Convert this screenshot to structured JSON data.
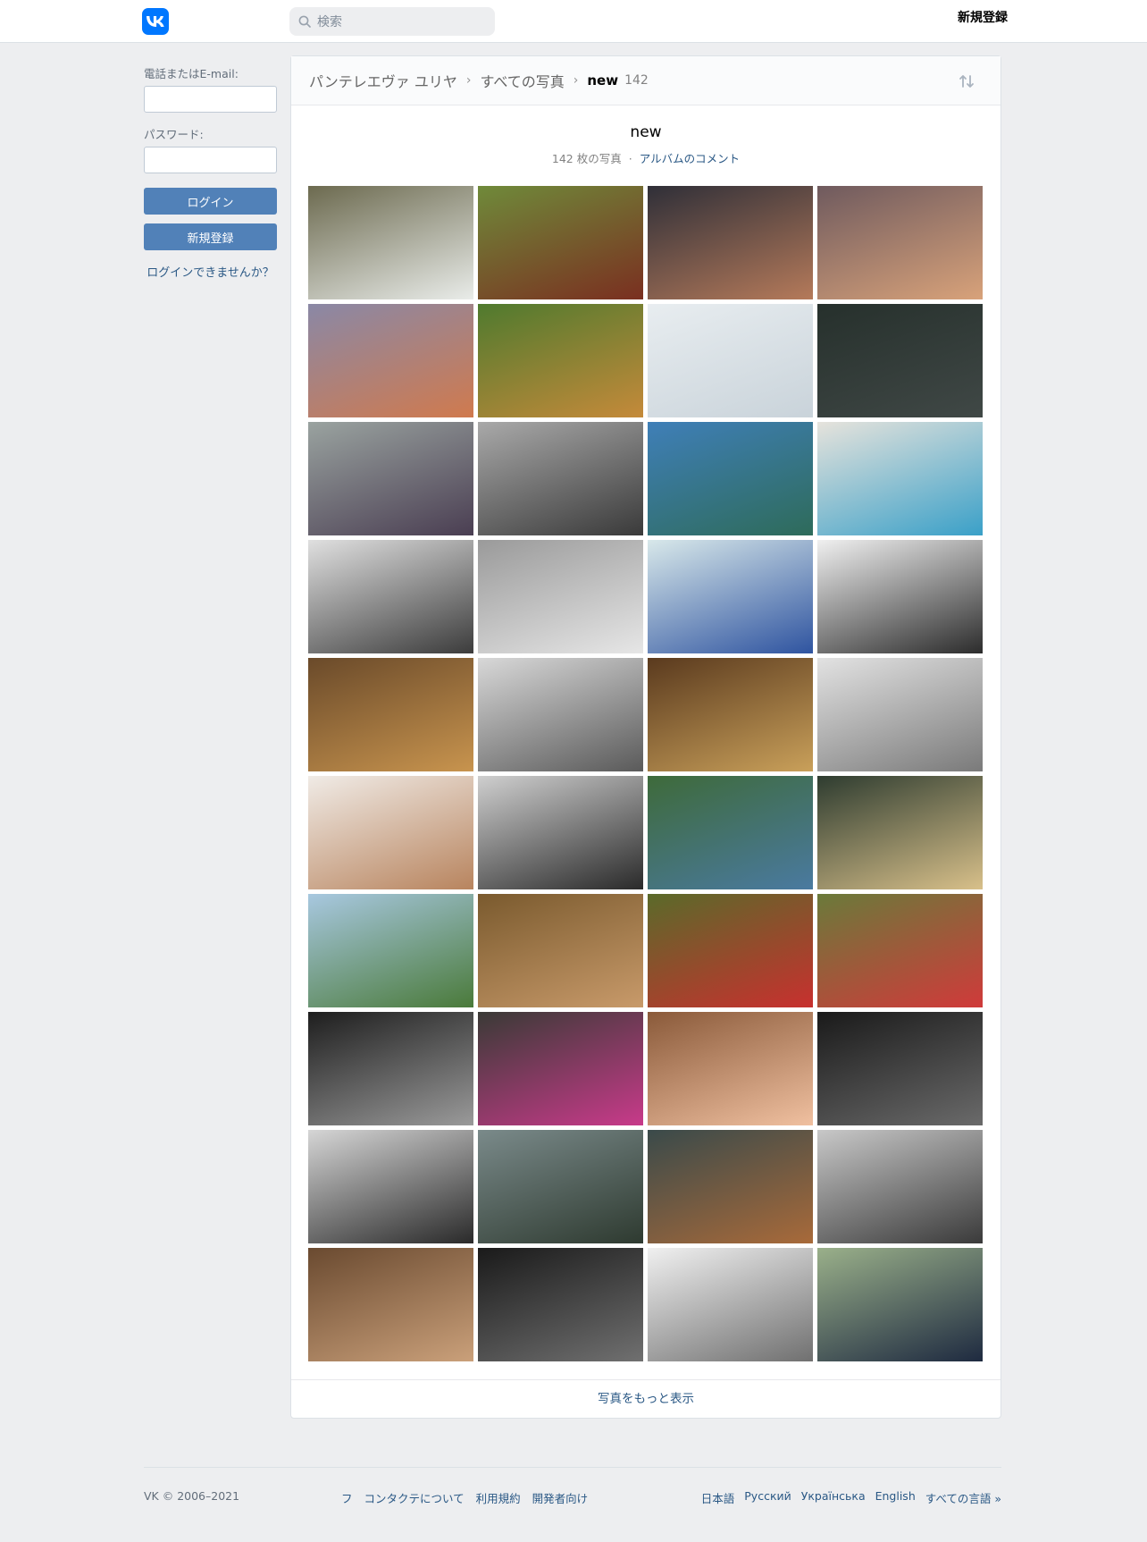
{
  "header": {
    "search_placeholder": "検索",
    "signup_label": "新規登録"
  },
  "sidebar": {
    "phone_label": "電話またはE-mail:",
    "password_label": "パスワード:",
    "login_button": "ログイン",
    "signup_button": "新規登録",
    "forgot_link": "ログインできませんか？"
  },
  "breadcrumb": {
    "user": "パンテレエヴァ ユリヤ",
    "all_photos": "すべての写真",
    "album": "new",
    "count": "142"
  },
  "album": {
    "title": "new",
    "photo_count": "142 枚の写真",
    "separator": "·",
    "comments_link": "アルバムのコメント"
  },
  "photos": [
    {
      "c1": "#6c6a4f",
      "c2": "#e9ece9"
    },
    {
      "c1": "#6f8a3a",
      "c2": "#7a2f20"
    },
    {
      "c1": "#2f2f38",
      "c2": "#b57a5a"
    },
    {
      "c1": "#6f5a5e",
      "c2": "#d8a27a"
    },
    {
      "c1": "#8a88a6",
      "c2": "#d07a4e"
    },
    {
      "c1": "#4f7a2e",
      "c2": "#c58a3a"
    },
    {
      "c1": "#e8edf0",
      "c2": "#c9d3da"
    },
    {
      "c1": "#26302c",
      "c2": "#404846"
    },
    {
      "c1": "#9aa3a0",
      "c2": "#4a3e52"
    },
    {
      "c1": "#a9a9a9",
      "c2": "#3a3a3a"
    },
    {
      "c1": "#3f7fb8",
      "c2": "#2e6b5a"
    },
    {
      "c1": "#e6e3dc",
      "c2": "#3aa0c8"
    },
    {
      "c1": "#e0e0e0",
      "c2": "#3c3c3c"
    },
    {
      "c1": "#9a9a9a",
      "c2": "#e6e6e6"
    },
    {
      "c1": "#d8e8ea",
      "c2": "#2f54a0"
    },
    {
      "c1": "#f0f0f0",
      "c2": "#2c2c2c"
    },
    {
      "c1": "#6a4a2a",
      "c2": "#c8944e"
    },
    {
      "c1": "#d8d8d8",
      "c2": "#5a5a5a"
    },
    {
      "c1": "#5a3a1e",
      "c2": "#c9a05a"
    },
    {
      "c1": "#e2e2e2",
      "c2": "#7a7a7a"
    },
    {
      "c1": "#f0ebe6",
      "c2": "#b8845e"
    },
    {
      "c1": "#cfcfcf",
      "c2": "#2a2a2a"
    },
    {
      "c1": "#3e6a3a",
      "c2": "#4a7aa0"
    },
    {
      "c1": "#2e3c30",
      "c2": "#d8c08a"
    },
    {
      "c1": "#a8c8e0",
      "c2": "#4a7a3a"
    },
    {
      "c1": "#7a5a2e",
      "c2": "#c89a6a"
    },
    {
      "c1": "#5a6a2a",
      "c2": "#c8302e"
    },
    {
      "c1": "#6a7a3a",
      "c2": "#d03a3a"
    },
    {
      "c1": "#1e1e1e",
      "c2": "#9a9a9a"
    },
    {
      "c1": "#3a3a36",
      "c2": "#c83a8a"
    },
    {
      "c1": "#8a5a3a",
      "c2": "#f0c0a0"
    },
    {
      "c1": "#1a1a1a",
      "c2": "#6a6a6a"
    },
    {
      "c1": "#d6d6d6",
      "c2": "#2a2a2a"
    },
    {
      "c1": "#7a8a8a",
      "c2": "#2e3a30"
    },
    {
      "c1": "#3a4a4a",
      "c2": "#a86a3a"
    },
    {
      "c1": "#c8c8c8",
      "c2": "#3a3a3a"
    },
    {
      "c1": "#6a4a30",
      "c2": "#caa07a"
    },
    {
      "c1": "#1a1a1a",
      "c2": "#707070"
    },
    {
      "c1": "#f0f0f0",
      "c2": "#707070"
    },
    {
      "c1": "#9ab08a",
      "c2": "#1e2a40"
    }
  ],
  "more_link": "写真をもっと表示",
  "footer": {
    "copyright": "VK © 2006–2021",
    "links": [
      "フ",
      "コンタクテについて",
      "利用規約",
      "開発者向け"
    ],
    "languages": [
      "日本語",
      "Русский",
      "Українська",
      "English",
      "すべての言語 »"
    ]
  }
}
